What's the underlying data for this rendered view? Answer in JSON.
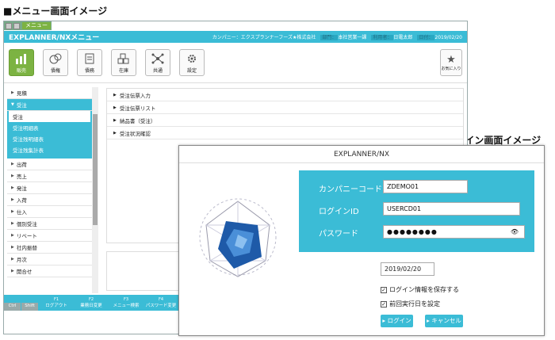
{
  "headings": {
    "menu": "■メニュー画面イメージ",
    "login": "■ログイン画面イメージ"
  },
  "menu_window": {
    "tab_label": "メニュー",
    "title": "EXPLANNER/NXメニュー",
    "meta": [
      {
        "key": "カンパニー：",
        "val": "エクスプランナーフーズ★株式会社"
      },
      {
        "key": "部門：",
        "val": "本社営業一課"
      },
      {
        "key": "利用者：",
        "val": "日電太郎"
      },
      {
        "key": "日付：",
        "val": "2019/02/20"
      }
    ],
    "toolbar": [
      "販売",
      "債権",
      "債務",
      "在庫",
      "共通",
      "設定"
    ],
    "favorites": "お気に入り",
    "sidebar": {
      "before": [
        "見積"
      ],
      "open_label": "受注",
      "sub": [
        "受注",
        "受注明細表",
        "受注残明細表",
        "受注残集計表"
      ],
      "after": [
        "出荷",
        "売上",
        "発注",
        "入荷",
        "仕入",
        "個別受注",
        "リベート",
        "社内振替",
        "月次",
        "開合せ"
      ]
    },
    "content_items": [
      "受注伝票入力",
      "受注伝票リスト",
      "納品書（受注）",
      "受注状況確認"
    ],
    "fkeys": [
      {
        "n": "",
        "l": "Ctrl"
      },
      {
        "n": "",
        "l": "Shift"
      },
      {
        "n": "F1",
        "l": "ログアウト"
      },
      {
        "n": "F2",
        "l": "業務日変更"
      },
      {
        "n": "F3",
        "l": "メニュー検索"
      },
      {
        "n": "F4",
        "l": "パスワード変更"
      }
    ]
  },
  "login_window": {
    "title": "EXPLANNER/NX",
    "company_label": "カンパニーコード",
    "company_value": "ZDEMO01",
    "login_label": "ログインID",
    "login_value": "USERCD01",
    "password_label": "パスワード",
    "password_value": "●●●●●●●●",
    "date_value": "2019/02/20",
    "save_login": "ログイン情報を保存する",
    "prev_date": "前回実行日を設定",
    "login_button": "▸ ログイン",
    "cancel_button": "▸ キャンセル"
  }
}
